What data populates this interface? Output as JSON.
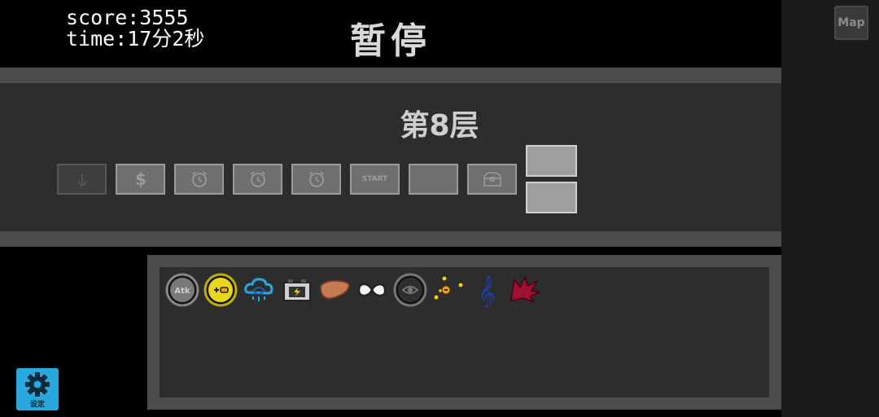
{
  "hud": {
    "score_line": "score:3555",
    "time_line": "time:17分2秒",
    "pause_title": "暂停"
  },
  "map_button": {
    "label": "Map"
  },
  "floor": {
    "title": "第8层",
    "slots": [
      {
        "icon": "down-arrow-icon",
        "label": ""
      },
      {
        "icon": "dollar-icon",
        "label": ""
      },
      {
        "icon": "alarm-clock-icon",
        "label": ""
      },
      {
        "icon": "alarm-clock-icon",
        "label": ""
      },
      {
        "icon": "alarm-clock-icon",
        "label": ""
      },
      {
        "icon": "",
        "label": "START"
      },
      {
        "icon": "",
        "label": ""
      },
      {
        "icon": "treasure-chest-icon",
        "label": ""
      }
    ]
  },
  "inventory": {
    "items": [
      {
        "name": "atk-orb-icon",
        "text": "Atk"
      },
      {
        "name": "plus-battery-orb-icon",
        "text": ""
      },
      {
        "name": "cloud-knot-icon",
        "text": ""
      },
      {
        "name": "battery-box-icon",
        "text": ""
      },
      {
        "name": "liver-icon",
        "text": ""
      },
      {
        "name": "infinity-icon",
        "text": ""
      },
      {
        "name": "eye-orb-icon",
        "text": ""
      },
      {
        "name": "orbit-dots-icon",
        "text": ""
      },
      {
        "name": "treble-clef-icon",
        "text": ""
      },
      {
        "name": "red-leaf-icon",
        "text": ""
      }
    ]
  },
  "settings": {
    "label": "设定"
  },
  "colors": {
    "background": "#000000",
    "panel_frame": "#4b4b4b",
    "panel_inner": "#2d2d2d",
    "settings_accent": "#29a8e0"
  }
}
